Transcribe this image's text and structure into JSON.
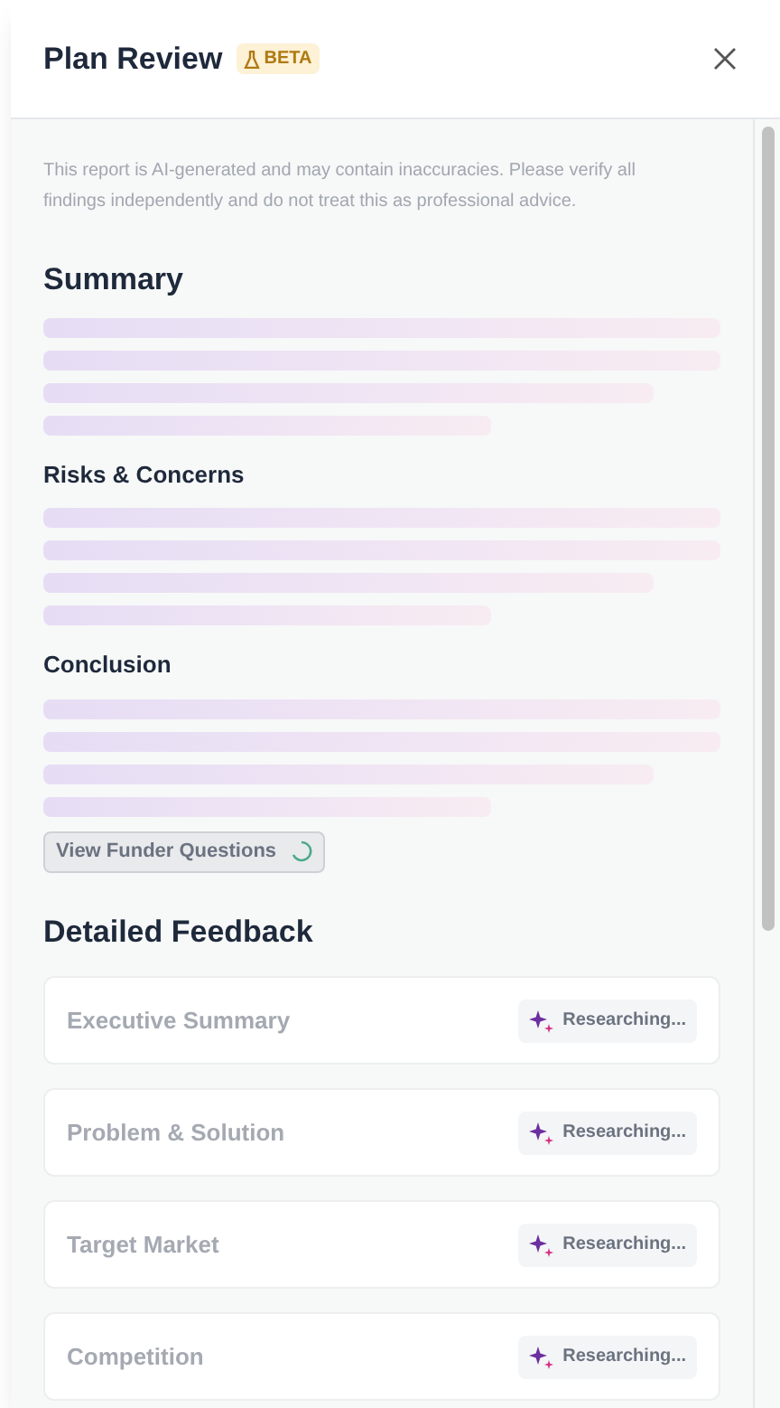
{
  "header": {
    "title": "Plan Review",
    "badge": "BETA"
  },
  "disclaimer": "This report is AI-generated and may contain inaccuracies. Please verify all findings independently and do not treat this as professional advice.",
  "summary_title": "Summary",
  "sections": [
    {
      "title": "Risks & Concerns"
    },
    {
      "title": "Conclusion"
    }
  ],
  "funder_button": {
    "label": "View Funder Questions",
    "loading": true
  },
  "feedback_title": "Detailed Feedback",
  "feedback": [
    {
      "title": "Executive Summary",
      "status": "Researching..."
    },
    {
      "title": "Problem & Solution",
      "status": "Researching..."
    },
    {
      "title": "Target Market",
      "status": "Researching..."
    },
    {
      "title": "Competition",
      "status": "Researching..."
    }
  ]
}
